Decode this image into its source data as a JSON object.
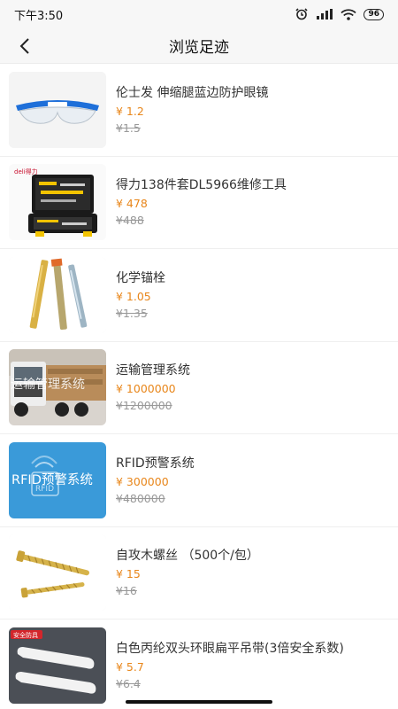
{
  "status": {
    "time": "下午3:50",
    "battery": "96"
  },
  "header": {
    "title": "浏览足迹",
    "back_icon": "chevron-left-icon"
  },
  "items": [
    {
      "name": "伦士发 伸缩腿蓝边防护眼镜",
      "price": "¥ 1.2",
      "original": "¥1.5"
    },
    {
      "name": "得力138件套DL5966维修工具",
      "price": "¥ 478",
      "original": "¥488"
    },
    {
      "name": "化学锚栓",
      "price": "¥ 1.05",
      "original": "¥1.35"
    },
    {
      "name": "运输管理系统",
      "price": "¥ 1000000",
      "original": "¥1200000"
    },
    {
      "name": "RFID预警系统",
      "price": "¥ 300000",
      "original": "¥480000"
    },
    {
      "name": "自攻木螺丝 （500个/包）",
      "price": "¥ 15",
      "original": "¥16"
    },
    {
      "name": "白色丙纶双头环眼扁平吊带(3倍安全系数)",
      "price": "¥ 5.7",
      "original": "¥6.4"
    }
  ],
  "thumb_text": {
    "deli_logo": "deli得力",
    "rfid": "RFID预警系统",
    "rfid_small": "RFID",
    "truck_text": "运输管理系统",
    "sling_tag": "安全防具"
  },
  "colors": {
    "price": "#e8861a",
    "rfid_bg": "#3a9ad9",
    "glasses_blue": "#1e6fd9"
  }
}
